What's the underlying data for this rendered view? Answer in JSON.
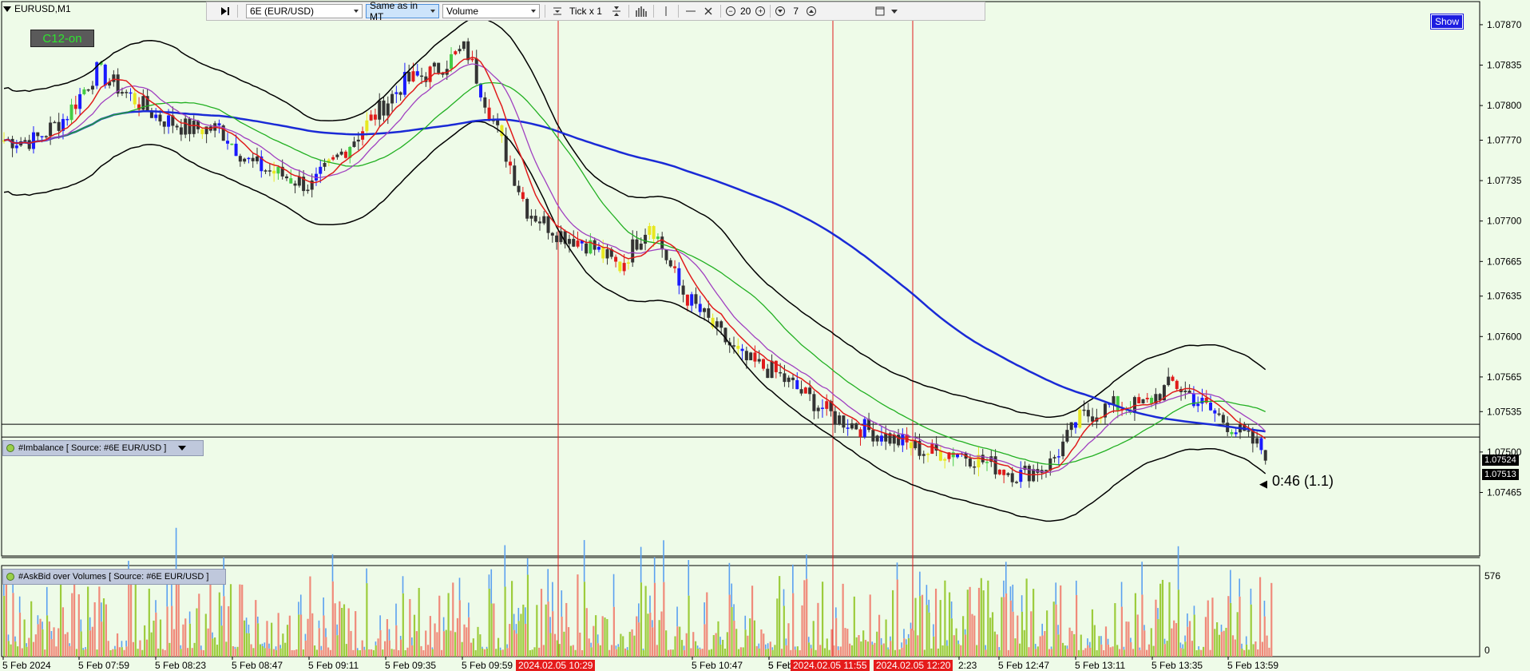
{
  "window": {
    "symbol_title": "EURUSD,M1"
  },
  "badge": {
    "label": "C12-on"
  },
  "toolbar": {
    "instrument": "6E (EUR/USD)",
    "price_mode": "Same as in MT",
    "volume": "Volume",
    "tick": "Tick x 1",
    "zoom_value": "20",
    "depth_value": "7"
  },
  "show_button": {
    "label": "Show"
  },
  "price_axis": {
    "labels": [
      "1.07870",
      "1.07835",
      "1.07800",
      "1.07770",
      "1.07735",
      "1.07700",
      "1.07665",
      "1.07635",
      "1.07600",
      "1.07565",
      "1.07535",
      "1.07500",
      "1.07465"
    ],
    "min": 1.0741,
    "max": 1.0789
  },
  "price_tags": {
    "upper": "1.07524",
    "lower": "1.07513"
  },
  "countdown": "0:46 (1.1)",
  "indicators": {
    "imbalance": "#Imbalance [ Source: #6E EUR/USD ]",
    "askbid": "#AskBid over Volumes [ Source: #6E EUR/USD ]"
  },
  "volume_axis": {
    "top": "576",
    "bottom": "0"
  },
  "time_axis": {
    "labels": [
      "5 Feb 2024",
      "5 Feb 07:59",
      "5 Feb 08:23",
      "5 Feb 08:47",
      "5 Feb 09:11",
      "5 Feb 09:35",
      "5 Feb 09:59",
      "5 Feb 10:47",
      "5 Feb 11:11",
      "5 Fe",
      "2:23",
      "5 Feb 12:47",
      "5 Feb 13:11",
      "5 Feb 13:35",
      "5 Feb 13:59"
    ]
  },
  "highlighted_dates": [
    "2024.02.05 10:29",
    "2024.02.05 11:55",
    "2024.02.05 12:20"
  ],
  "colors": {
    "background": "#eefbe8",
    "bull_candle": "#1a1aff",
    "bear_candle": "#e01b1b",
    "ma_fast": "#e01b1b",
    "ma_mid": "#a040c0",
    "ma_slow": "#22b022",
    "ma_long": "#1a2ad6",
    "band": "#000000"
  },
  "chart_data": {
    "type": "line",
    "series": [
      {
        "values": [
          1.0777,
          1.0777,
          1.0779,
          1.0783,
          1.0781,
          1.0779,
          1.0778,
          1.0778,
          1.0775,
          1.0774,
          1.0773,
          1.0776,
          1.0779,
          1.0782,
          1.0783,
          1.0785,
          1.0778,
          1.0771,
          1.0769,
          1.0768,
          1.0766,
          1.077,
          1.0764,
          1.0761,
          1.0758,
          1.0757,
          1.0755,
          1.0753,
          1.0752,
          1.0751,
          1.075,
          1.075,
          1.0749,
          1.0748,
          1.0749,
          1.0753,
          1.0754,
          1.0754,
          1.0756,
          1.0754,
          1.0752,
          1.075
        ]
      }
    ]
  }
}
